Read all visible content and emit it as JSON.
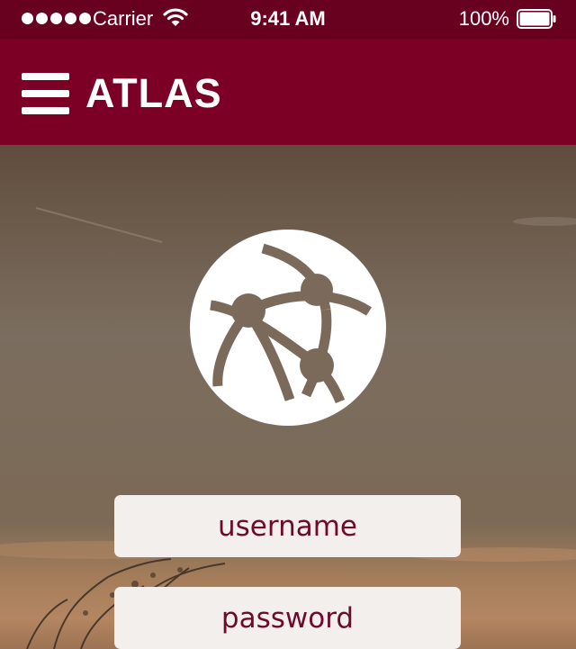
{
  "status_bar": {
    "carrier": "Carrier",
    "time": "9:41 AM",
    "battery_percent": "100%",
    "battery_level": 1.0,
    "signal_bars": 5
  },
  "nav_bar": {
    "title": "ATLAS",
    "menu_icon": "hamburger-menu-icon",
    "background_color": "#7c0025"
  },
  "logo": {
    "icon": "network-globe-icon"
  },
  "login_form": {
    "username_placeholder": "username",
    "password_placeholder": "password"
  },
  "colors": {
    "status_bar": "#680020",
    "accent": "#7c0025",
    "field_background": "#f2efec",
    "field_text": "#6e0a2c"
  }
}
